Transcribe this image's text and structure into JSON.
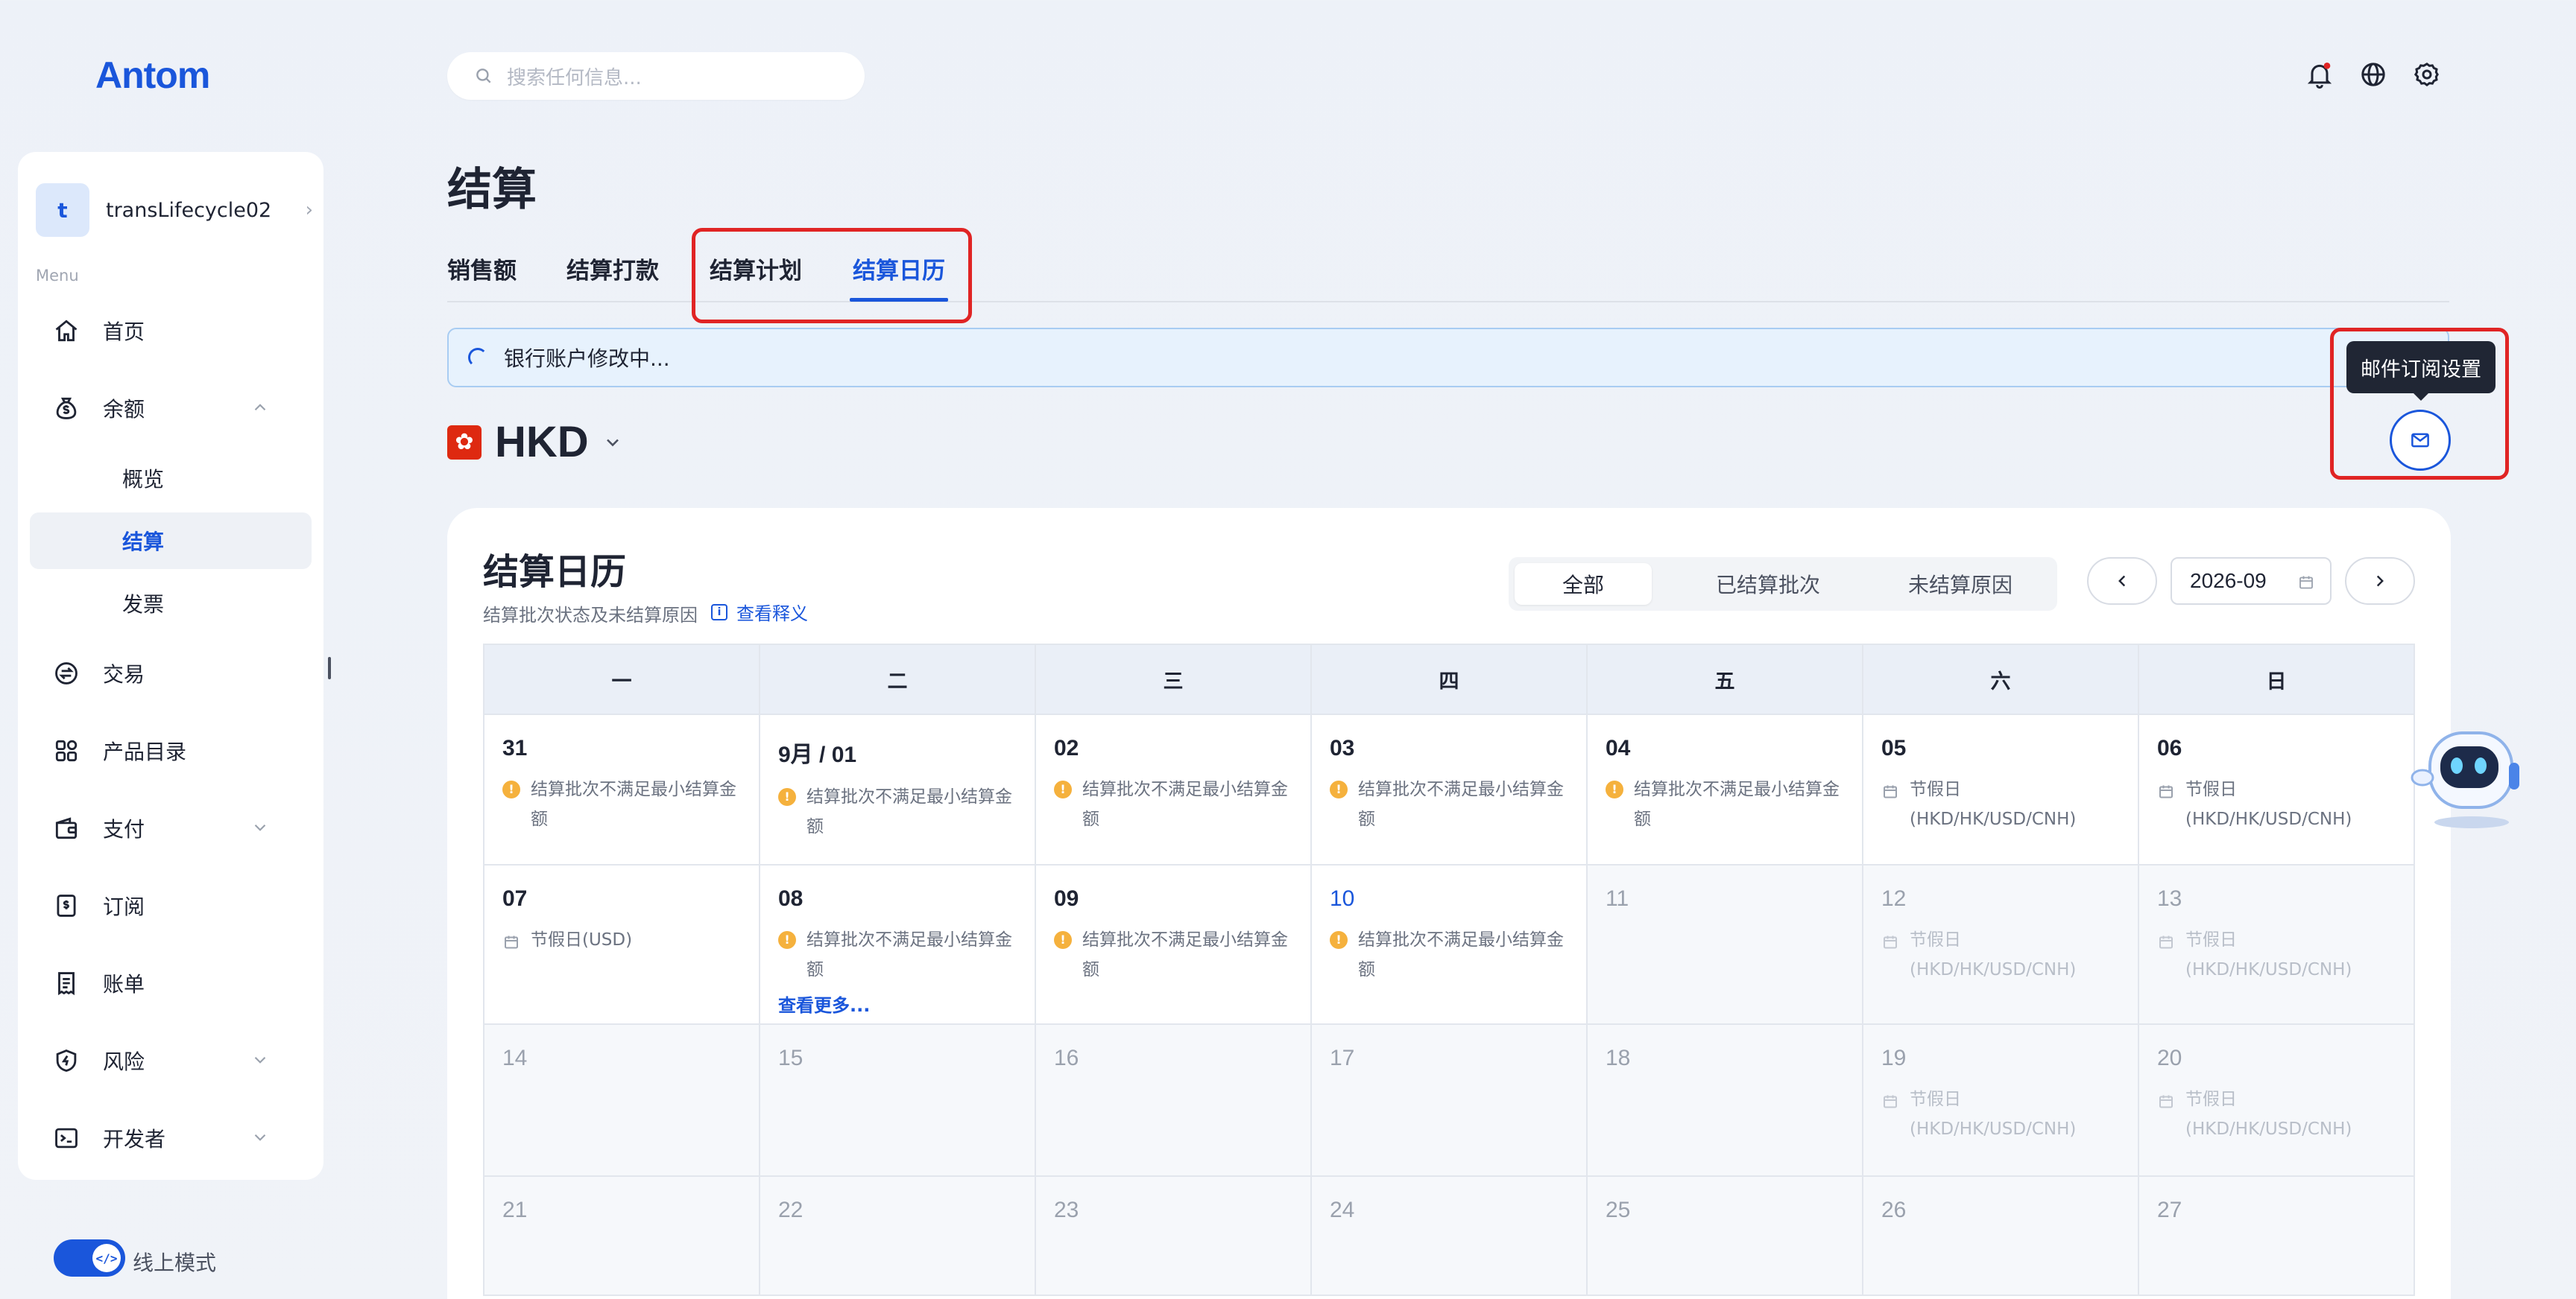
{
  "brand": {
    "logo": "Antom"
  },
  "search": {
    "placeholder": "搜索任何信息..."
  },
  "topbar": {
    "icons": [
      "bell-icon",
      "globe-icon",
      "gear-icon"
    ]
  },
  "sidebar": {
    "account": {
      "initial": "t",
      "name": "transLifecycle02"
    },
    "menu_caption": "Menu",
    "items": [
      {
        "label": "首页",
        "icon": "home-icon"
      },
      {
        "label": "余额",
        "icon": "money-bag-icon",
        "expanded": true
      },
      {
        "label": "概览",
        "sub": true
      },
      {
        "label": "结算",
        "sub": true,
        "active": true
      },
      {
        "label": "发票",
        "sub": true
      },
      {
        "label": "交易",
        "icon": "exchange-icon"
      },
      {
        "label": "产品目录",
        "icon": "grid-icon"
      },
      {
        "label": "支付",
        "icon": "wallet-icon"
      },
      {
        "label": "订阅",
        "icon": "subscription-icon"
      },
      {
        "label": "账单",
        "icon": "bill-icon"
      },
      {
        "label": "风险",
        "icon": "shield-icon"
      },
      {
        "label": "开发者",
        "icon": "terminal-icon"
      }
    ],
    "mode_label": "线上模式"
  },
  "page": {
    "title": "结算",
    "tabs": [
      "销售额",
      "结算打款",
      "结算计划",
      "结算日历"
    ],
    "active_tab": "结算日历",
    "banner": "银行账户修改中...",
    "currency": "HKD",
    "tooltip": "邮件订阅设置"
  },
  "calendar": {
    "title": "结算日历",
    "subtitle": "结算批次状态及未结算原因",
    "help_link": "查看释义",
    "filters": [
      "全部",
      "已结算批次",
      "未结算原因"
    ],
    "active_filter": "全部",
    "month": "2026-09",
    "weekdays": [
      "一",
      "二",
      "三",
      "四",
      "五",
      "六",
      "日"
    ],
    "weeks": [
      [
        {
          "day": "31",
          "note": "结算批次不满足最小结算金额",
          "kind": "warn"
        },
        {
          "day": "9月 / 01",
          "note": "结算批次不满足最小结算金额",
          "kind": "warn"
        },
        {
          "day": "02",
          "note": "结算批次不满足最小结算金额",
          "kind": "warn"
        },
        {
          "day": "03",
          "note": "结算批次不满足最小结算金额",
          "kind": "warn"
        },
        {
          "day": "04",
          "note": "结算批次不满足最小结算金额",
          "kind": "warn"
        },
        {
          "day": "05",
          "note": "节假日(HKD/HK/USD/CNH)",
          "kind": "holiday"
        },
        {
          "day": "06",
          "note": "节假日(HKD/HK/USD/CNH)",
          "kind": "holiday"
        }
      ],
      [
        {
          "day": "07",
          "note": "节假日(USD)",
          "kind": "holiday"
        },
        {
          "day": "08",
          "note": "结算批次不满足最小结算金额",
          "kind": "warn",
          "more": "查看更多..."
        },
        {
          "day": "09",
          "note": "结算批次不满足最小结算金额",
          "kind": "warn"
        },
        {
          "day": "10",
          "note": "结算批次不满足最小结算金额",
          "kind": "warn",
          "today": true
        },
        {
          "day": "11",
          "future": true
        },
        {
          "day": "12",
          "note": "节假日(HKD/HK/USD/CNH)",
          "kind": "holiday",
          "future": true
        },
        {
          "day": "13",
          "note": "节假日(HKD/HK/USD/CNH)",
          "kind": "holiday",
          "future": true
        }
      ],
      [
        {
          "day": "14",
          "future": true
        },
        {
          "day": "15",
          "future": true
        },
        {
          "day": "16",
          "future": true
        },
        {
          "day": "17",
          "future": true
        },
        {
          "day": "18",
          "future": true
        },
        {
          "day": "19",
          "note": "节假日(HKD/HK/USD/CNH)",
          "kind": "holiday",
          "future": true
        },
        {
          "day": "20",
          "note": "节假日(HKD/HK/USD/CNH)",
          "kind": "holiday",
          "future": true
        }
      ],
      [
        {
          "day": "21",
          "future": true
        },
        {
          "day": "22",
          "future": true
        },
        {
          "day": "23",
          "future": true
        },
        {
          "day": "24",
          "future": true
        },
        {
          "day": "25",
          "future": true
        },
        {
          "day": "26",
          "future": true
        },
        {
          "day": "27",
          "future": true
        }
      ]
    ]
  },
  "colors": {
    "accent": "#1a56db",
    "highlight": "#e02424",
    "warn": "#f5b13d"
  }
}
